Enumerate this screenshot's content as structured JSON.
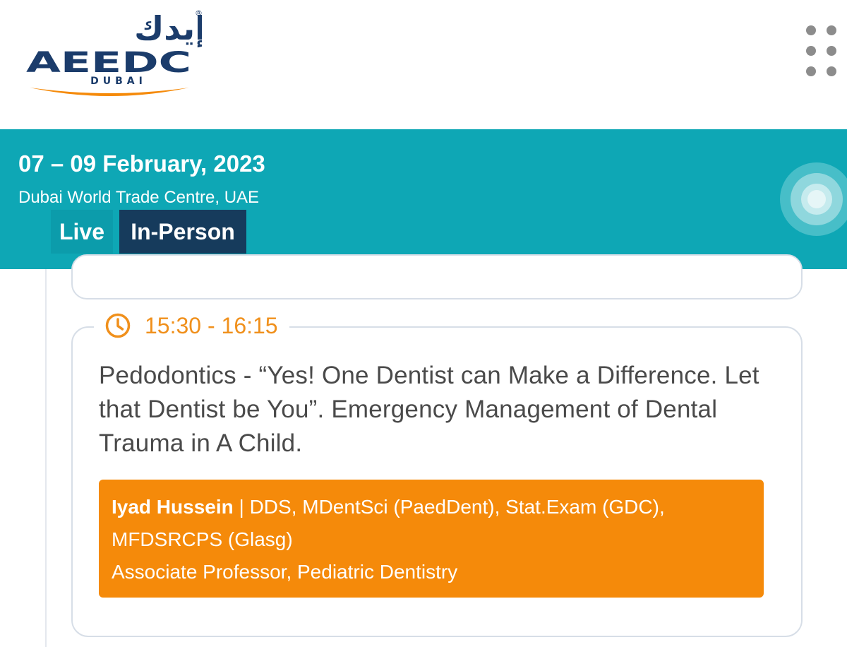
{
  "header": {
    "logo": {
      "arabic_text": "إيدك",
      "wordmark": "AEEDC",
      "city": "DUBAI",
      "registered_mark": "®"
    },
    "menu_icon": "grid-dots-icon"
  },
  "event": {
    "dates": "07 – 09 February, 2023",
    "venue": "Dubai World Trade Centre, UAE",
    "badges": {
      "live": "Live",
      "in_person": "In-Person"
    }
  },
  "session": {
    "time": "15:30 - 16:15",
    "title": "Pedodontics - “Yes! One Dentist can Make a Difference. Let that Dentist be You”. Emergency Management of Dental Trauma in A Child.",
    "speaker": {
      "name": "Iyad Hussein",
      "separator": " | ",
      "credentials": "DDS, MDentSci (PaedDent), Stat.Exam (GDC), MFDSRCPS (Glasg)",
      "position": "Associate Professor, Pediatric Dentistry"
    }
  },
  "colors": {
    "band": "#0ea7b5",
    "live_badge": "#0c9cab",
    "in_person_badge": "#163b5c",
    "accent_orange": "#f58a0a",
    "time_orange": "#f0901c",
    "logo_navy": "#1b3c6b"
  }
}
